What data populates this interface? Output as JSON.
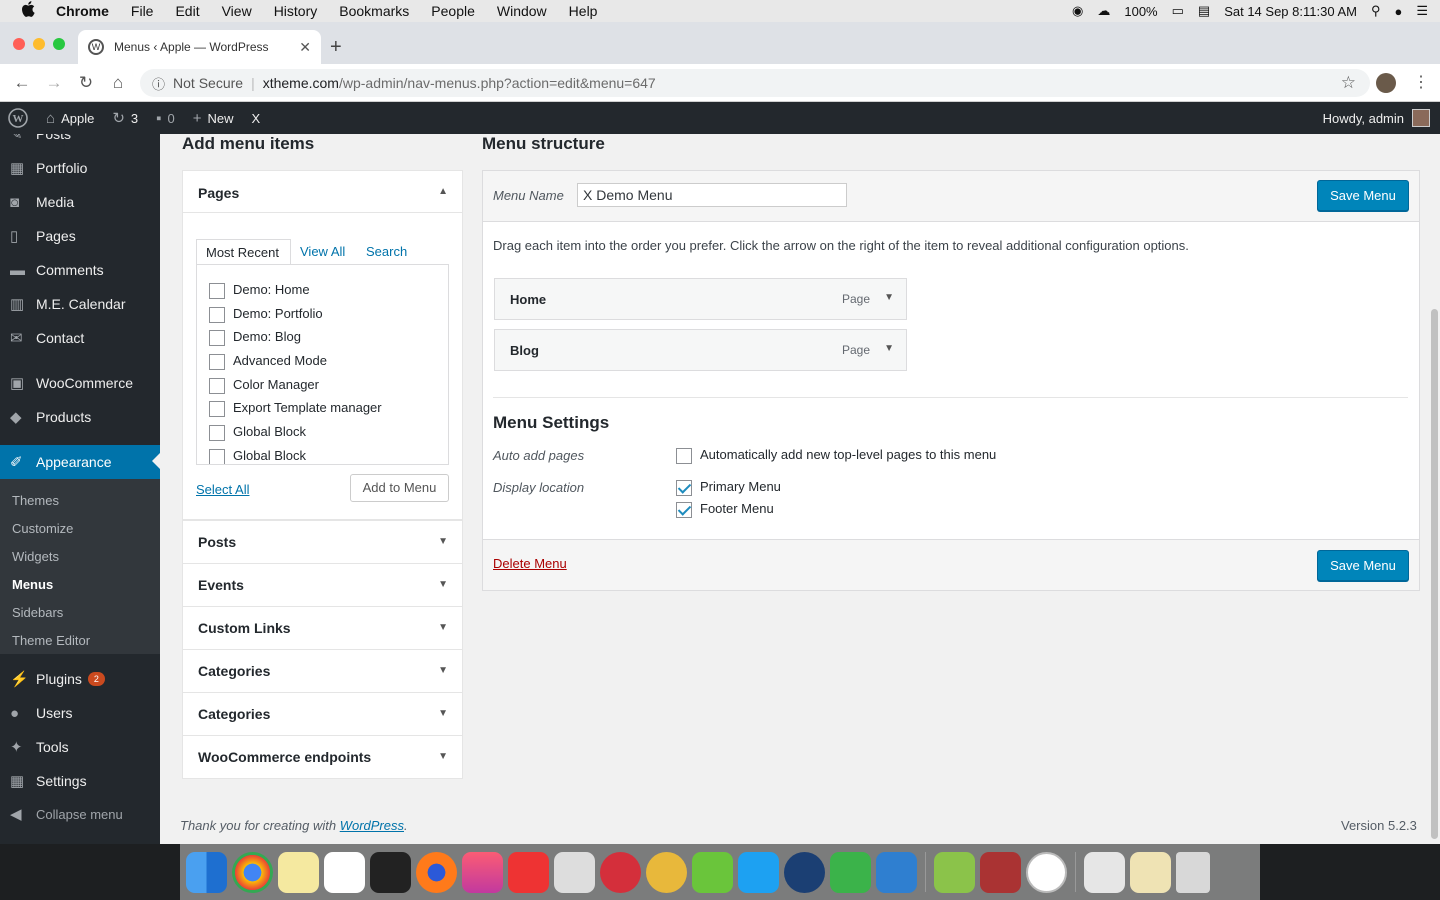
{
  "mac_menu": {
    "apple": "",
    "app": "Chrome",
    "items": [
      "File",
      "Edit",
      "View",
      "History",
      "Bookmarks",
      "People",
      "Window",
      "Help"
    ],
    "battery": "100%",
    "clock": "Sat 14 Sep  8:11:30 AM"
  },
  "browser": {
    "tab_title": "Menus ‹ Apple — WordPress",
    "security": "Not Secure",
    "url_host": "xtheme.com",
    "url_path": "/wp-admin/nav-menus.php?action=edit&menu=647"
  },
  "wp_bar": {
    "site": "Apple",
    "updates": "3",
    "comments": "0",
    "new": "New",
    "x": "X",
    "howdy": "Howdy, admin"
  },
  "sidebar": {
    "items": [
      {
        "label": "Posts",
        "icon": "pin-icon"
      },
      {
        "label": "Portfolio",
        "icon": "portfolio-icon"
      },
      {
        "label": "Media",
        "icon": "media-icon"
      },
      {
        "label": "Pages",
        "icon": "pages-icon"
      },
      {
        "label": "Comments",
        "icon": "comments-icon"
      },
      {
        "label": "M.E. Calendar",
        "icon": "calendar-icon"
      },
      {
        "label": "Contact",
        "icon": "mail-icon"
      },
      {
        "label": "WooCommerce",
        "icon": "woo-icon"
      },
      {
        "label": "Products",
        "icon": "products-icon"
      },
      {
        "label": "Appearance",
        "icon": "brush-icon"
      }
    ],
    "submenu": [
      "Themes",
      "Customize",
      "Widgets",
      "Menus",
      "Sidebars",
      "Theme Editor"
    ],
    "bottom": [
      {
        "label": "Plugins",
        "badge": "2"
      },
      {
        "label": "Users"
      },
      {
        "label": "Tools"
      },
      {
        "label": "Settings"
      },
      {
        "label": "Collapse menu"
      }
    ]
  },
  "add_items": {
    "heading": "Add menu items",
    "pages_title": "Pages",
    "tabs": [
      "Most Recent",
      "View All",
      "Search"
    ],
    "pages": [
      "Demo: Home",
      "Demo: Portfolio",
      "Demo: Blog",
      "Advanced Mode",
      "Color Manager",
      "Export Template manager",
      "Global Block",
      "Global Block"
    ],
    "select_all": "Select All",
    "add_button": "Add to Menu",
    "sections": [
      "Posts",
      "Events",
      "Custom Links",
      "Categories",
      "Categories",
      "WooCommerce endpoints"
    ]
  },
  "structure": {
    "heading": "Menu structure",
    "menu_name_label": "Menu Name",
    "menu_name_value": "X Demo Menu",
    "save_label": "Save Menu",
    "instructions": "Drag each item into the order you prefer. Click the arrow on the right of the item to reveal additional configuration options.",
    "items": [
      {
        "name": "Home",
        "type": "Page"
      },
      {
        "name": "Blog",
        "type": "Page"
      }
    ],
    "settings_title": "Menu Settings",
    "auto_add_label": "Auto add pages",
    "auto_add_text": "Automatically add new top-level pages to this menu",
    "display_label": "Display location",
    "locations": [
      "Primary Menu",
      "Footer Menu"
    ],
    "delete_label": "Delete Menu"
  },
  "footer": {
    "thanks": "Thank you for creating with",
    "wp_link": "WordPress",
    "period": ".",
    "version": "Version 5.2.3"
  }
}
